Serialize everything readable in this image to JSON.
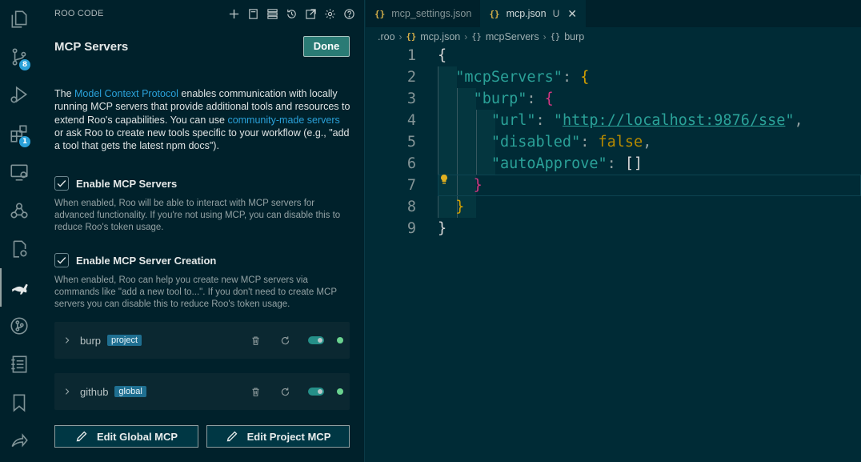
{
  "activity_bar": {
    "items": [
      {
        "name": "explorer-icon"
      },
      {
        "name": "source-control-icon",
        "badge": "8"
      },
      {
        "name": "run-debug-icon"
      },
      {
        "name": "extensions-icon",
        "badge": "1"
      },
      {
        "name": "remote-explorer-icon"
      },
      {
        "name": "webhooks-icon"
      },
      {
        "name": "search-remote-icon"
      },
      {
        "name": "roo-kangaroo-icon"
      },
      {
        "name": "git-graph-icon"
      },
      {
        "name": "notebook-icon"
      },
      {
        "name": "bookmarks-icon"
      },
      {
        "name": "live-share-icon"
      }
    ]
  },
  "sidebar": {
    "title": "ROO CODE",
    "mcp_title": "MCP Servers",
    "done_label": "Done",
    "intro": {
      "p1": "The ",
      "link1": "Model Context Protocol",
      "p2": " enables communication with locally running MCP servers that provide additional tools and resources to extend Roo's capabilities. You can use ",
      "link2": "community-made servers",
      "p3": " or ask Roo to create new tools specific to your workflow (e.g., \"add a tool that gets the latest npm docs\")."
    },
    "enable_servers": {
      "label": "Enable MCP Servers",
      "checked": true,
      "description": "When enabled, Roo will be able to interact with MCP servers for advanced functionality. If you're not using MCP, you can disable this to reduce Roo's token usage."
    },
    "enable_creation": {
      "label": "Enable MCP Server Creation",
      "checked": true,
      "description": "When enabled, Roo can help you create new MCP servers via commands like \"add a new tool to...\". If you don't need to create MCP servers you can disable this to reduce Roo's token usage."
    },
    "servers": [
      {
        "name": "burp",
        "scope": "project",
        "enabled": true,
        "status_color": "#6ad28f"
      },
      {
        "name": "github",
        "scope": "global",
        "enabled": true,
        "status_color": "#6ad28f"
      }
    ],
    "edit_global_label": "Edit Global MCP",
    "edit_project_label": "Edit Project MCP"
  },
  "editor": {
    "tabs": [
      {
        "label": "mcp_settings.json",
        "active": false
      },
      {
        "label": "mcp.json",
        "active": true,
        "modified": "U"
      }
    ],
    "breadcrumb": [
      ".roo",
      "mcp.json",
      "mcpServers",
      "burp"
    ],
    "line_numbers": [
      "1",
      "2",
      "3",
      "4",
      "5",
      "6",
      "7",
      "8",
      "9"
    ],
    "code": {
      "key_mcp": "\"mcpServers\"",
      "key_burp": "\"burp\"",
      "key_url": "\"url\"",
      "url_quote_open": "\"",
      "url_value": "http://localhost:9876/sse",
      "url_quote_close": "\"",
      "key_disabled": "\"disabled\"",
      "val_disabled": "false",
      "key_auto": "\"autoApprove\"",
      "val_auto": "[]"
    }
  },
  "colors": {
    "background": "#002b36",
    "sidebar": "#00212b",
    "accent": "#2aa198",
    "link": "#2aa1d9",
    "keyword": "#b58900"
  }
}
